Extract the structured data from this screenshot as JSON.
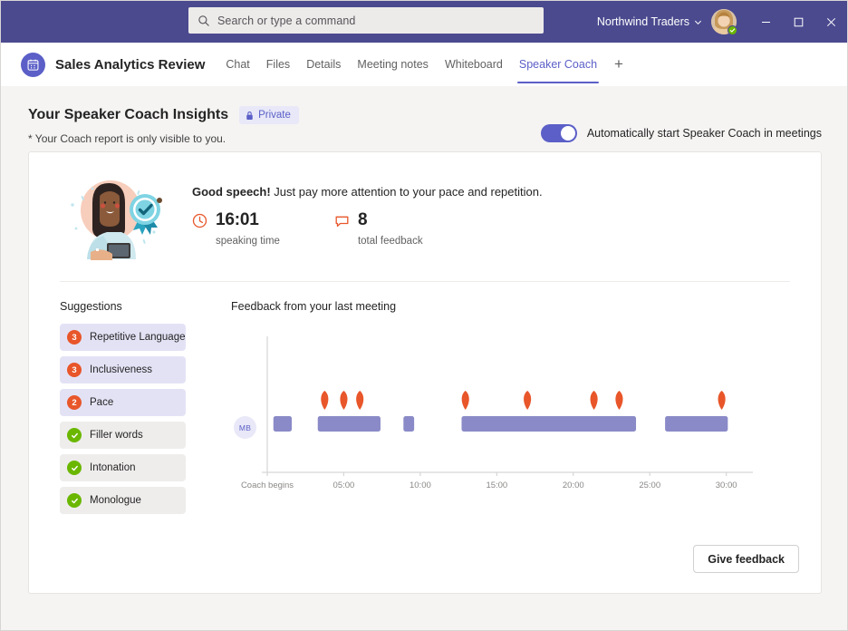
{
  "titlebar": {
    "search_placeholder": "Search or type a command",
    "search_icon": "search-icon",
    "org_name": "Northwind Traders",
    "org_chevron": "chevron-down-icon",
    "presence_status": "available",
    "minimize_label": "–",
    "maximize_label": "□",
    "close_label": "✕"
  },
  "tabbar": {
    "meeting_icon": "calendar-icon",
    "meeting_title": "Sales Analytics Review",
    "tabs": [
      {
        "label": "Chat",
        "active": false
      },
      {
        "label": "Files",
        "active": false
      },
      {
        "label": "Details",
        "active": false
      },
      {
        "label": "Meeting notes",
        "active": false
      },
      {
        "label": "Whiteboard",
        "active": false
      },
      {
        "label": "Speaker Coach",
        "active": true
      }
    ],
    "add_tab_label": "+"
  },
  "header": {
    "title": "Your Speaker Coach Insights",
    "private_badge": "Private",
    "lock_icon": "lock-icon",
    "subtitle": "* Your Coach report is only visible to you.",
    "toggle_label": "Automatically start Speaker Coach in meetings",
    "toggle_on": true
  },
  "summary": {
    "illustration": "woman-with-award-badge-illustration",
    "headline_bold": "Good speech!",
    "headline_rest": " Just pay more attention to your pace and repetition.",
    "metrics": [
      {
        "icon": "clock-icon",
        "value": "16:01",
        "label": "speaking time"
      },
      {
        "icon": "comment-icon",
        "value": "8",
        "label": "total feedback"
      }
    ]
  },
  "suggestions": {
    "title": "Suggestions",
    "items": [
      {
        "label": "Repetitive Language",
        "count": "3",
        "state": "warn"
      },
      {
        "label": "Inclusiveness",
        "count": "3",
        "state": "warn"
      },
      {
        "label": "Pace",
        "count": "2",
        "state": "warn"
      },
      {
        "label": "Filler words",
        "count": "",
        "state": "ok"
      },
      {
        "label": "Intonation",
        "count": "",
        "state": "ok"
      },
      {
        "label": "Monologue",
        "count": "",
        "state": "ok"
      }
    ]
  },
  "chart_data": {
    "type": "bar",
    "title": "Feedback from your last meeting",
    "xlabel": "",
    "ylabel": "",
    "speaker_initials": "MB",
    "xlim": [
      0,
      31.5
    ],
    "grid": false,
    "legend": null,
    "tick_labels": [
      "Coach begins",
      "05:00",
      "10:00",
      "15:00",
      "20:00",
      "25:00",
      "30:00"
    ],
    "tick_values": [
      0,
      5,
      10,
      15,
      20,
      25,
      30
    ],
    "series": [
      {
        "name": "Speaking segments",
        "type": "timeline-bars",
        "color": "#8a8ac8",
        "segments": [
          {
            "start": 0.4,
            "end": 1.6
          },
          {
            "start": 3.3,
            "end": 7.4
          },
          {
            "start": 8.9,
            "end": 9.6
          },
          {
            "start": 12.7,
            "end": 24.1
          },
          {
            "start": 26.0,
            "end": 30.1
          }
        ]
      },
      {
        "name": "Feedback markers",
        "type": "pin-markers",
        "color": "#e8562a",
        "positions": [
          3.75,
          5.0,
          6.05,
          12.95,
          17.0,
          21.35,
          23.0,
          29.7
        ]
      }
    ]
  },
  "footer": {
    "give_feedback_label": "Give feedback"
  }
}
